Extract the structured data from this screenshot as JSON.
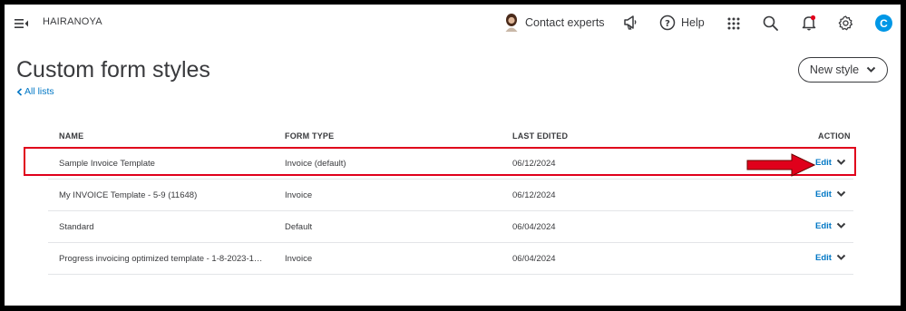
{
  "topbar": {
    "company": "HAIRANOYA",
    "contact_label": "Contact experts",
    "help_label": "Help",
    "user_initial": "C",
    "avatar_color": "#0097e6",
    "notification_dot_color": "#e0001b"
  },
  "page": {
    "title": "Custom form styles",
    "back_link": "All lists",
    "new_style_label": "New style"
  },
  "table": {
    "headers": {
      "name": "NAME",
      "form_type": "FORM TYPE",
      "last_edited": "LAST EDITED",
      "action": "ACTION"
    },
    "rows": [
      {
        "name": "Sample Invoice Template",
        "form_type": "Invoice (default)",
        "last_edited": "06/12/2024",
        "action": "Edit",
        "highlighted": true
      },
      {
        "name": "My INVOICE Template - 5-9 (11648)",
        "form_type": "Invoice",
        "last_edited": "06/12/2024",
        "action": "Edit"
      },
      {
        "name": "Standard",
        "form_type": "Default",
        "last_edited": "06/04/2024",
        "action": "Edit"
      },
      {
        "name": "Progress invoicing optimized template - 1-8-2023-1…",
        "form_type": "Invoice",
        "last_edited": "06/04/2024",
        "action": "Edit"
      }
    ]
  },
  "colors": {
    "link": "#0077c5",
    "annotation_red": "#e0001b",
    "text": "#393a3d"
  }
}
